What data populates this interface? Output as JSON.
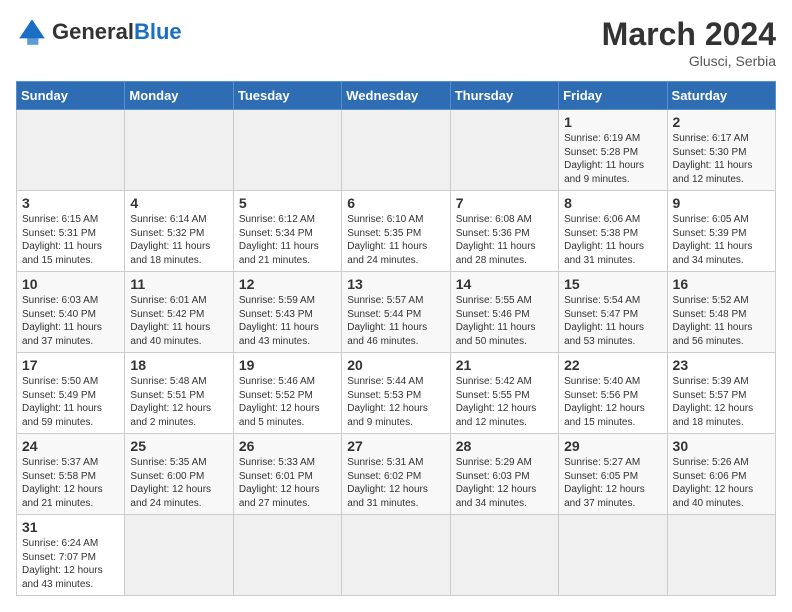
{
  "logo": {
    "general": "General",
    "blue": "Blue"
  },
  "header": {
    "title": "March 2024",
    "subtitle": "Glusci, Serbia"
  },
  "weekdays": [
    "Sunday",
    "Monday",
    "Tuesday",
    "Wednesday",
    "Thursday",
    "Friday",
    "Saturday"
  ],
  "weeks": [
    [
      {
        "day": "",
        "info": ""
      },
      {
        "day": "",
        "info": ""
      },
      {
        "day": "",
        "info": ""
      },
      {
        "day": "",
        "info": ""
      },
      {
        "day": "",
        "info": ""
      },
      {
        "day": "1",
        "info": "Sunrise: 6:19 AM\nSunset: 5:28 PM\nDaylight: 11 hours\nand 9 minutes."
      },
      {
        "day": "2",
        "info": "Sunrise: 6:17 AM\nSunset: 5:30 PM\nDaylight: 11 hours\nand 12 minutes."
      }
    ],
    [
      {
        "day": "3",
        "info": "Sunrise: 6:15 AM\nSunset: 5:31 PM\nDaylight: 11 hours\nand 15 minutes."
      },
      {
        "day": "4",
        "info": "Sunrise: 6:14 AM\nSunset: 5:32 PM\nDaylight: 11 hours\nand 18 minutes."
      },
      {
        "day": "5",
        "info": "Sunrise: 6:12 AM\nSunset: 5:34 PM\nDaylight: 11 hours\nand 21 minutes."
      },
      {
        "day": "6",
        "info": "Sunrise: 6:10 AM\nSunset: 5:35 PM\nDaylight: 11 hours\nand 24 minutes."
      },
      {
        "day": "7",
        "info": "Sunrise: 6:08 AM\nSunset: 5:36 PM\nDaylight: 11 hours\nand 28 minutes."
      },
      {
        "day": "8",
        "info": "Sunrise: 6:06 AM\nSunset: 5:38 PM\nDaylight: 11 hours\nand 31 minutes."
      },
      {
        "day": "9",
        "info": "Sunrise: 6:05 AM\nSunset: 5:39 PM\nDaylight: 11 hours\nand 34 minutes."
      }
    ],
    [
      {
        "day": "10",
        "info": "Sunrise: 6:03 AM\nSunset: 5:40 PM\nDaylight: 11 hours\nand 37 minutes."
      },
      {
        "day": "11",
        "info": "Sunrise: 6:01 AM\nSunset: 5:42 PM\nDaylight: 11 hours\nand 40 minutes."
      },
      {
        "day": "12",
        "info": "Sunrise: 5:59 AM\nSunset: 5:43 PM\nDaylight: 11 hours\nand 43 minutes."
      },
      {
        "day": "13",
        "info": "Sunrise: 5:57 AM\nSunset: 5:44 PM\nDaylight: 11 hours\nand 46 minutes."
      },
      {
        "day": "14",
        "info": "Sunrise: 5:55 AM\nSunset: 5:46 PM\nDaylight: 11 hours\nand 50 minutes."
      },
      {
        "day": "15",
        "info": "Sunrise: 5:54 AM\nSunset: 5:47 PM\nDaylight: 11 hours\nand 53 minutes."
      },
      {
        "day": "16",
        "info": "Sunrise: 5:52 AM\nSunset: 5:48 PM\nDaylight: 11 hours\nand 56 minutes."
      }
    ],
    [
      {
        "day": "17",
        "info": "Sunrise: 5:50 AM\nSunset: 5:49 PM\nDaylight: 11 hours\nand 59 minutes."
      },
      {
        "day": "18",
        "info": "Sunrise: 5:48 AM\nSunset: 5:51 PM\nDaylight: 12 hours\nand 2 minutes."
      },
      {
        "day": "19",
        "info": "Sunrise: 5:46 AM\nSunset: 5:52 PM\nDaylight: 12 hours\nand 5 minutes."
      },
      {
        "day": "20",
        "info": "Sunrise: 5:44 AM\nSunset: 5:53 PM\nDaylight: 12 hours\nand 9 minutes."
      },
      {
        "day": "21",
        "info": "Sunrise: 5:42 AM\nSunset: 5:55 PM\nDaylight: 12 hours\nand 12 minutes."
      },
      {
        "day": "22",
        "info": "Sunrise: 5:40 AM\nSunset: 5:56 PM\nDaylight: 12 hours\nand 15 minutes."
      },
      {
        "day": "23",
        "info": "Sunrise: 5:39 AM\nSunset: 5:57 PM\nDaylight: 12 hours\nand 18 minutes."
      }
    ],
    [
      {
        "day": "24",
        "info": "Sunrise: 5:37 AM\nSunset: 5:58 PM\nDaylight: 12 hours\nand 21 minutes."
      },
      {
        "day": "25",
        "info": "Sunrise: 5:35 AM\nSunset: 6:00 PM\nDaylight: 12 hours\nand 24 minutes."
      },
      {
        "day": "26",
        "info": "Sunrise: 5:33 AM\nSunset: 6:01 PM\nDaylight: 12 hours\nand 27 minutes."
      },
      {
        "day": "27",
        "info": "Sunrise: 5:31 AM\nSunset: 6:02 PM\nDaylight: 12 hours\nand 31 minutes."
      },
      {
        "day": "28",
        "info": "Sunrise: 5:29 AM\nSunset: 6:03 PM\nDaylight: 12 hours\nand 34 minutes."
      },
      {
        "day": "29",
        "info": "Sunrise: 5:27 AM\nSunset: 6:05 PM\nDaylight: 12 hours\nand 37 minutes."
      },
      {
        "day": "30",
        "info": "Sunrise: 5:26 AM\nSunset: 6:06 PM\nDaylight: 12 hours\nand 40 minutes."
      }
    ],
    [
      {
        "day": "31",
        "info": "Sunrise: 6:24 AM\nSunset: 7:07 PM\nDaylight: 12 hours\nand 43 minutes."
      },
      {
        "day": "",
        "info": ""
      },
      {
        "day": "",
        "info": ""
      },
      {
        "day": "",
        "info": ""
      },
      {
        "day": "",
        "info": ""
      },
      {
        "day": "",
        "info": ""
      },
      {
        "day": "",
        "info": ""
      }
    ]
  ]
}
